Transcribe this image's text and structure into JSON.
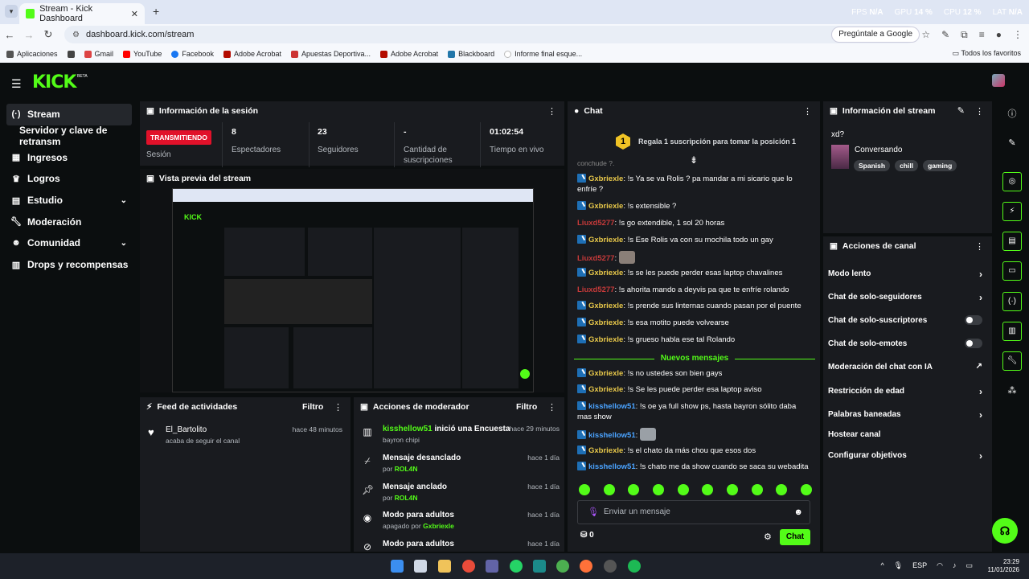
{
  "browser": {
    "tab_title": "Stream - Kick Dashboard",
    "new_tab": "+",
    "url": "dashboard.kick.com/stream",
    "ask_google": "Pregúntale a Google",
    "perf": {
      "fps_label": "FPS",
      "fps": "N/A",
      "gpu_label": "GPU",
      "gpu": "14 %",
      "cpu_label": "CPU",
      "cpu": "12 %",
      "lat_label": "LAT",
      "lat": "N/A"
    },
    "bookmarks": [
      "Aplicaciones",
      "Gmail",
      "YouTube",
      "Facebook",
      "Adobe Acrobat",
      "Apuestas Deportiva...",
      "Adobe Acrobat",
      "Blackboard",
      "Informe final esque..."
    ],
    "all_bookmarks": "Todos los favoritos"
  },
  "header": {
    "logo": "KICK",
    "beta": "BETA"
  },
  "sidebar": {
    "items": [
      {
        "label": "Stream",
        "icon": "stream-icon"
      },
      {
        "label": "Servidor y clave de retransm"
      },
      {
        "label": "Ingresos",
        "icon": "income-icon"
      },
      {
        "label": "Logros",
        "icon": "trophy-icon"
      },
      {
        "label": "Estudio",
        "icon": "studio-icon"
      },
      {
        "label": "Moderación",
        "icon": "wrench-icon"
      },
      {
        "label": "Comunidad",
        "icon": "community-icon"
      },
      {
        "label": "Drops y recompensas",
        "icon": "drops-icon"
      }
    ]
  },
  "session": {
    "title": "Información de la sesión",
    "live_badge": "TRANSMITIENDO",
    "session_label": "Sesión",
    "stats": [
      {
        "value": "8",
        "label": "Espectadores"
      },
      {
        "value": "23",
        "label": "Seguidores"
      },
      {
        "value": "-",
        "label": "Cantidad de suscripciones"
      },
      {
        "value": "01:02:54",
        "label": "Tiempo en vivo"
      }
    ]
  },
  "preview": {
    "title": "Vista previa del stream"
  },
  "activity": {
    "title": "Feed de actividades",
    "filter": "Filtro",
    "items": [
      {
        "name": "El_Bartolito",
        "text": "acaba de seguir el canal",
        "time": "hace 48 minutos"
      }
    ]
  },
  "modactions": {
    "title": "Acciones de moderador",
    "filter": "Filtro",
    "items": [
      {
        "user": "kisshellow51",
        "title": " inició una Encuesta",
        "sub": "bayron chipi",
        "time": "hace 29 minutos"
      },
      {
        "title": "Mensaje desanclado",
        "by": "por ",
        "user": "ROL4N",
        "time": "hace 1 día"
      },
      {
        "title": "Mensaje anclado",
        "by": "por ",
        "user": "ROL4N",
        "time": "hace 1 día"
      },
      {
        "title": "Modo para adultos",
        "by": "apagado por ",
        "user": "Gxbriexle",
        "time": "hace 1 día"
      },
      {
        "title": "Modo para adultos",
        "time": "hace 1 día"
      }
    ]
  },
  "chat": {
    "title": "Chat",
    "sub_banner_num": "1",
    "sub_banner": "Regala 1 suscripción para tomar la posición 1",
    "cutoff": "conchude ?.",
    "messages": [
      {
        "user": "Gxbriexle",
        "text": ": !s Ya se va Rolis ? pa mandar a mi sicario que lo enfríe ?"
      },
      {
        "user": "Gxbriexle",
        "text": ": !s extensible ?"
      },
      {
        "user": "Liuxd5277",
        "text": ": !s go extendible, 1 sol 20 horas"
      },
      {
        "user": "Gxbriexle",
        "text": ": !s Ese Rolis va con su mochila todo un gay"
      },
      {
        "user": "Liuxd5277",
        "text": ":"
      },
      {
        "user": "Gxbriexle",
        "text": ": !s se les puede perder esas laptop chavalines"
      },
      {
        "user": "Liuxd5277",
        "text": ": !s ahorita mando a deyvis pa que te enfríe rolando"
      },
      {
        "user": "Gxbriexle",
        "text": ": !s prende sus linternas cuando pasan por el puente"
      },
      {
        "user": "Gxbriexle",
        "text": ": !s esa motito puede volvearse"
      },
      {
        "user": "Gxbriexle",
        "text": ": !s grueso habla ese tal Rolando"
      },
      {
        "user": "Gxbriexle",
        "text": ": !s no ustedes son bien gays"
      },
      {
        "user": "Gxbriexle",
        "text": ": !s Se les puede perder esa laptop aviso"
      },
      {
        "user": "kisshellow51",
        "text": ": !s oe ya full show ps, hasta bayron sólito daba mas show"
      },
      {
        "user": "kisshellow51",
        "text": ":"
      },
      {
        "user": "Gxbriexle",
        "text": ": !s el chato da más chou que esos dos"
      },
      {
        "user": "kisshellow51",
        "text": ": !s chato me da show cuando se saca su webadita"
      }
    ],
    "new_messages": "Nuevos mensajes",
    "input_placeholder": "Enviar un mensaje",
    "points": "0",
    "send": "Chat"
  },
  "streaminfo": {
    "title": "Información del stream",
    "stream_title": "xd?",
    "category": "Conversando",
    "tags": [
      "Spanish",
      "chill",
      "gaming"
    ]
  },
  "channel": {
    "title": "Acciones de canal",
    "rows": [
      {
        "label": "Modo lento",
        "kind": "arrow"
      },
      {
        "label": "Chat de solo-seguidores",
        "kind": "arrow"
      },
      {
        "label": "Chat de solo-suscriptores",
        "kind": "toggle"
      },
      {
        "label": "Chat de solo-emotes",
        "kind": "toggle"
      },
      {
        "label": "Moderación del chat con IA",
        "kind": "external"
      },
      {
        "label": "Restricción de edad",
        "kind": "arrow"
      },
      {
        "label": "Palabras baneadas",
        "kind": "arrow"
      },
      {
        "label": "Hostear canal",
        "kind": "none"
      },
      {
        "label": "Configurar objetivos",
        "kind": "arrow"
      }
    ]
  },
  "taskbar": {
    "lang": "ESP",
    "time": "23:29",
    "date": "11/01/2026"
  }
}
